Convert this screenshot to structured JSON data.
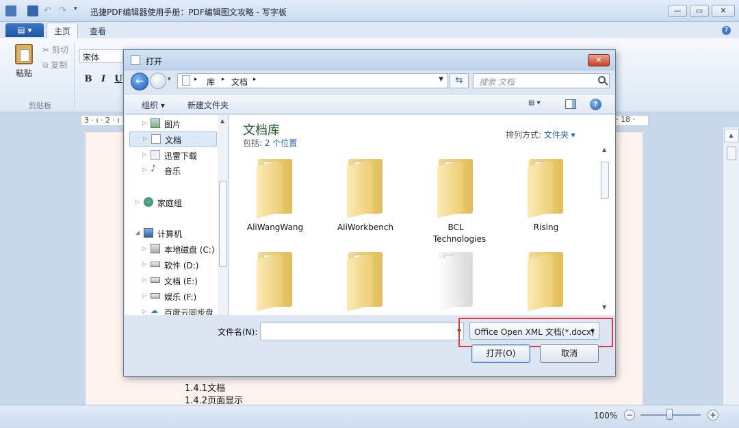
{
  "app": {
    "title": "迅捷PDF编辑器使用手册：PDF编辑图文攻略 - 写字板",
    "menu_button": "▤ ▾",
    "tabs": [
      "主页",
      "查看"
    ],
    "window_controls": {
      "minimize": "—",
      "maximize": "▭",
      "close": "✕"
    }
  },
  "ribbon": {
    "paste_label": "粘贴",
    "cut_label": "剪切",
    "copy_label": "复制",
    "clipboard_group": "剪贴板",
    "font_name": "宋体",
    "bold": "B",
    "italic": "I",
    "underline": "U"
  },
  "ruler": {
    "left_text": "3 · ı · 2 · ı ·",
    "right_text": "· 18 ·"
  },
  "document": {
    "lines": [
      "1.4.1文档",
      "1.4.2页面显示"
    ]
  },
  "statusbar": {
    "zoom": "100%",
    "zoom_out": "−",
    "zoom_in": "+",
    "zoom_level": 1.0
  },
  "dialog": {
    "title": "打开",
    "close": "✕",
    "address": {
      "root_sep": "▸",
      "crumbs": [
        "库",
        "文档"
      ]
    },
    "search_placeholder": "搜索 文档",
    "toolbar": {
      "organize": "组织 ▾",
      "new_folder": "新建文件夹",
      "help": "?"
    },
    "nav_items": [
      {
        "label": "图片",
        "icon": "pictures-icon"
      },
      {
        "label": "文档",
        "icon": "documents-icon",
        "selected": true
      },
      {
        "label": "迅雷下载",
        "icon": "download-icon"
      },
      {
        "label": "音乐",
        "icon": "music-icon"
      },
      {
        "label": "家庭组",
        "icon": "homegroup-icon"
      },
      {
        "label": "计算机",
        "icon": "computer-icon"
      },
      {
        "label": "本地磁盘 (C:)",
        "icon": "drive-icon"
      },
      {
        "label": "软件 (D:)",
        "icon": "drive-icon"
      },
      {
        "label": "文档 (E:)",
        "icon": "drive-icon"
      },
      {
        "label": "娱乐 (F:)",
        "icon": "drive-icon"
      },
      {
        "label": "百度云同步盘",
        "icon": "cloud-icon"
      }
    ],
    "library": {
      "title": "文档库",
      "includes_label": "包括: ",
      "includes_link": "2 个位置",
      "arrange_label": "排列方式: ",
      "arrange_value": "文件夹 ▾"
    },
    "folders": [
      {
        "name": "AliWangWang"
      },
      {
        "name": "AliWorkbench"
      },
      {
        "name": "BCL Technologies"
      },
      {
        "name": "Rising"
      },
      {
        "name": ""
      },
      {
        "name": ""
      },
      {
        "name": ""
      },
      {
        "name": ""
      }
    ],
    "filename_label": "文件名(N):",
    "filename_value": "",
    "filetype": "Office Open XML 文档(*.docx)",
    "open_button": "打开(O)",
    "cancel_button": "取消"
  },
  "colors": {
    "highlight": "#e2373b",
    "link": "#1a66c0",
    "library_title": "#1e5a2c"
  }
}
